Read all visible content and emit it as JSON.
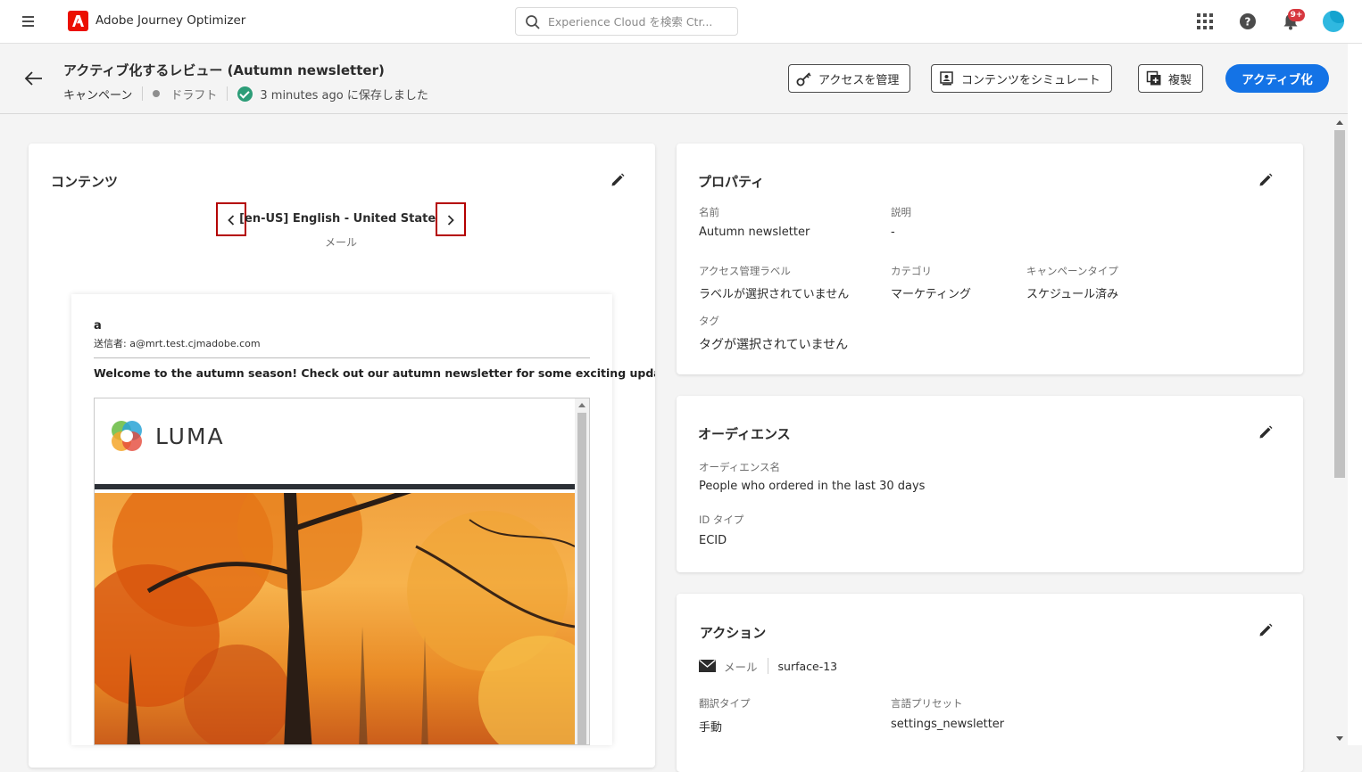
{
  "topbar": {
    "app_title": "Adobe Journey Optimizer",
    "search_placeholder": "Experience Cloud を検索 Ctr...",
    "notification_count": "9+"
  },
  "header": {
    "title": "アクティブ化するレビュー (Autumn newsletter)",
    "type": "キャンペーン",
    "status": "ドラフト",
    "saved_text": "3 minutes ago に保存しました",
    "buttons": {
      "access": "アクセスを管理",
      "simulate": "コンテンツをシミュレート",
      "duplicate": "複製",
      "activate": "アクティブ化"
    }
  },
  "content_card": {
    "title": "コンテンツ",
    "language": "[en-US] English - United States",
    "channel": "メール",
    "preview": {
      "subject": "a",
      "sender": "送信者: a@mrt.test.cjmadobe.com",
      "preheader": "Welcome to the autumn season! Check out our autumn newsletter for some exciting updates.",
      "brand": "LUMA"
    }
  },
  "properties_card": {
    "title": "プロパティ",
    "name_label": "名前",
    "name_value": "Autumn newsletter",
    "description_label": "説明",
    "description_value": "-",
    "access_label": "アクセス管理ラベル",
    "access_value": "ラベルが選択されていません",
    "category_label": "カテゴリ",
    "category_value": "マーケティング",
    "campaign_type_label": "キャンペーンタイプ",
    "campaign_type_value": "スケジュール済み",
    "tags_label": "タグ",
    "tags_value": "タグが選択されていません"
  },
  "audience_card": {
    "title": "オーディエンス",
    "audience_name_label": "オーディエンス名",
    "audience_name_value": "People who ordered in the last 30 days",
    "id_type_label": "ID タイプ",
    "id_type_value": "ECID"
  },
  "action_card": {
    "title": "アクション",
    "channel": "メール",
    "surface": "surface-13",
    "translation_type_label": "翻訳タイプ",
    "translation_type_value": "手動",
    "language_preset_label": "言語プリセット",
    "language_preset_value": "settings_newsletter"
  },
  "colors": {
    "accent": "#1473e6",
    "brand_red": "#eb1000",
    "success": "#2d9d78",
    "badge": "#d7373f"
  }
}
